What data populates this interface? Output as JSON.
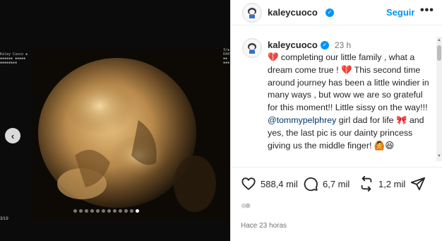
{
  "media": {
    "scan_left_text": "Kaley Cuoco ▪ ▪▪▪▪▪▪ ▪▪▪▪▪ ▪▪▪▪▪▪▪▪",
    "scan_right_text": "3/▪ 6447▪ ▪▪ ▪▪▪",
    "counter": "3/19",
    "carousel_dot_count": 12,
    "active_dot_index": 11,
    "prev_icon": "chevron-left-icon"
  },
  "header": {
    "username": "kaleycuoco",
    "verified_icon": "verified-badge-icon",
    "follow_label": "Seguir",
    "more_icon": "more-options-icon",
    "more_label": "•••"
  },
  "caption": {
    "username": "kaleycuoco",
    "time": "23 h",
    "segments": {
      "emoji1": "💔",
      "text1": " completing our little family , what a dream come true ! ",
      "emoji2": "💔",
      "text2": " This second time around journey has been a little windier in many ways , but wow we are so grateful for this moment!! Little sissy on the way!!! ",
      "mention": "@tommypelphrey",
      "text3": " girl dad for life ",
      "emoji3": "🎀",
      "text4": " and yes, the last pic is our dainty princess giving us the middle finger! ",
      "emoji4": "🙆",
      "emoji5": "😆"
    }
  },
  "actions": {
    "likes": "588,4 mil",
    "comments": "6,7 mil",
    "reposts": "1,2 mil"
  },
  "footer": {
    "timestamp": "Hace 23 horas"
  },
  "colors": {
    "accent": "#0095f6",
    "text": "#262626",
    "muted": "#737373",
    "border": "#efefef"
  }
}
